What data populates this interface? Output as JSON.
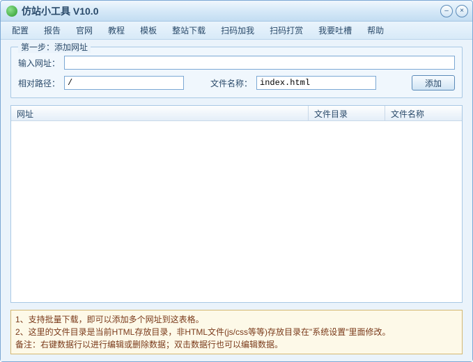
{
  "window": {
    "title": "仿站小工具 V10.0"
  },
  "menu": [
    "配置",
    "报告",
    "官网",
    "教程",
    "模板",
    "整站下载",
    "扫码加我",
    "扫码打赏",
    "我要吐槽",
    "帮助"
  ],
  "section": {
    "legend": "第一步：添加网址",
    "label_url": "输入网址：",
    "label_path": "相对路径：",
    "label_fname": "文件名称：",
    "value_path": "/",
    "value_fname": "index.html",
    "btn_add": "添加"
  },
  "table": {
    "columns": [
      "网址",
      "文件目录",
      "文件名称"
    ]
  },
  "notes": [
    "1、支持批量下载，即可以添加多个网址到这表格。",
    "2、这里的文件目录是当前HTML存放目录，非HTML文件(js/css等等)存放目录在\"系统设置\"里面修改。",
    "备注：右键数据行以进行编辑或删除数据；双击数据行也可以编辑数据。"
  ]
}
